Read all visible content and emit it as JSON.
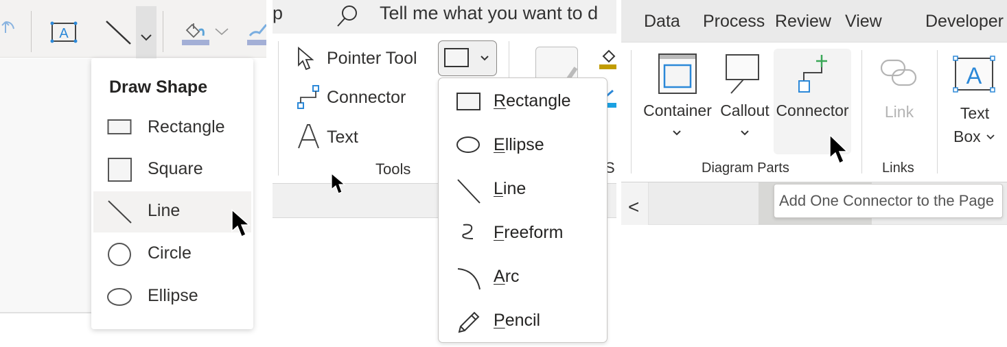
{
  "panel1": {
    "toolbar": {
      "icons": [
        "undo-icon",
        "text-box-icon",
        "line-icon",
        "chevron-down-icon",
        "fill-bucket-icon",
        "chevron-down-icon",
        "brush-icon"
      ]
    },
    "menu": {
      "title": "Draw Shape",
      "items": [
        {
          "label": "Rectangle",
          "icon": "rectangle-icon"
        },
        {
          "label": "Square",
          "icon": "square-icon"
        },
        {
          "label": "Line",
          "icon": "line-icon",
          "hovered": true
        },
        {
          "label": "Circle",
          "icon": "circle-icon"
        },
        {
          "label": "Ellipse",
          "icon": "ellipse-icon"
        }
      ]
    }
  },
  "panel2": {
    "search": {
      "lead_text": "p",
      "placeholder": "Tell me what you want to d"
    },
    "tools": [
      {
        "label": "Pointer Tool",
        "icon": "pointer-icon"
      },
      {
        "label": "Connector",
        "icon": "connector-icon"
      },
      {
        "label": "Text",
        "icon": "text-icon"
      }
    ],
    "group_label": "Tools",
    "partial_label": "S",
    "shape_dropdown": {
      "selected_icon": "rectangle-icon",
      "items": [
        {
          "accel": "R",
          "rest": "ectangle",
          "icon": "rectangle-icon"
        },
        {
          "accel": "E",
          "rest": "llipse",
          "icon": "ellipse-icon"
        },
        {
          "accel": "L",
          "rest": "ine",
          "icon": "line-icon"
        },
        {
          "accel": "F",
          "rest": "reeform",
          "icon": "freeform-icon"
        },
        {
          "accel": "A",
          "rest": "rc",
          "icon": "arc-icon"
        },
        {
          "accel": "P",
          "rest": "encil",
          "icon": "pencil-icon"
        }
      ]
    },
    "colors": {
      "fill_swatch": "#c19c00",
      "line_swatch": "#1ba1e2"
    }
  },
  "panel3": {
    "tabs": [
      "Data",
      "Process",
      "Review",
      "View",
      "Developer"
    ],
    "diagram_parts": {
      "group_label": "Diagram Parts",
      "buttons": [
        {
          "label": "Container",
          "has_dropdown": true,
          "icon": "container-icon"
        },
        {
          "label": "Callout",
          "has_dropdown": true,
          "icon": "callout-icon"
        },
        {
          "label": "Connector",
          "has_dropdown": false,
          "icon": "connector-add-icon",
          "hovered": true
        }
      ]
    },
    "links": {
      "group_label": "Links",
      "buttons": [
        {
          "label": "Link",
          "disabled": true,
          "icon": "link-icon"
        }
      ]
    },
    "text_box": {
      "label_line1": "Text",
      "label_line2": "Box"
    },
    "tooltip": "Add One Connector to the Page",
    "nav_back": "<",
    "colors": {
      "accent_blue": "#2b88d8",
      "add_green": "#3aa757"
    }
  }
}
